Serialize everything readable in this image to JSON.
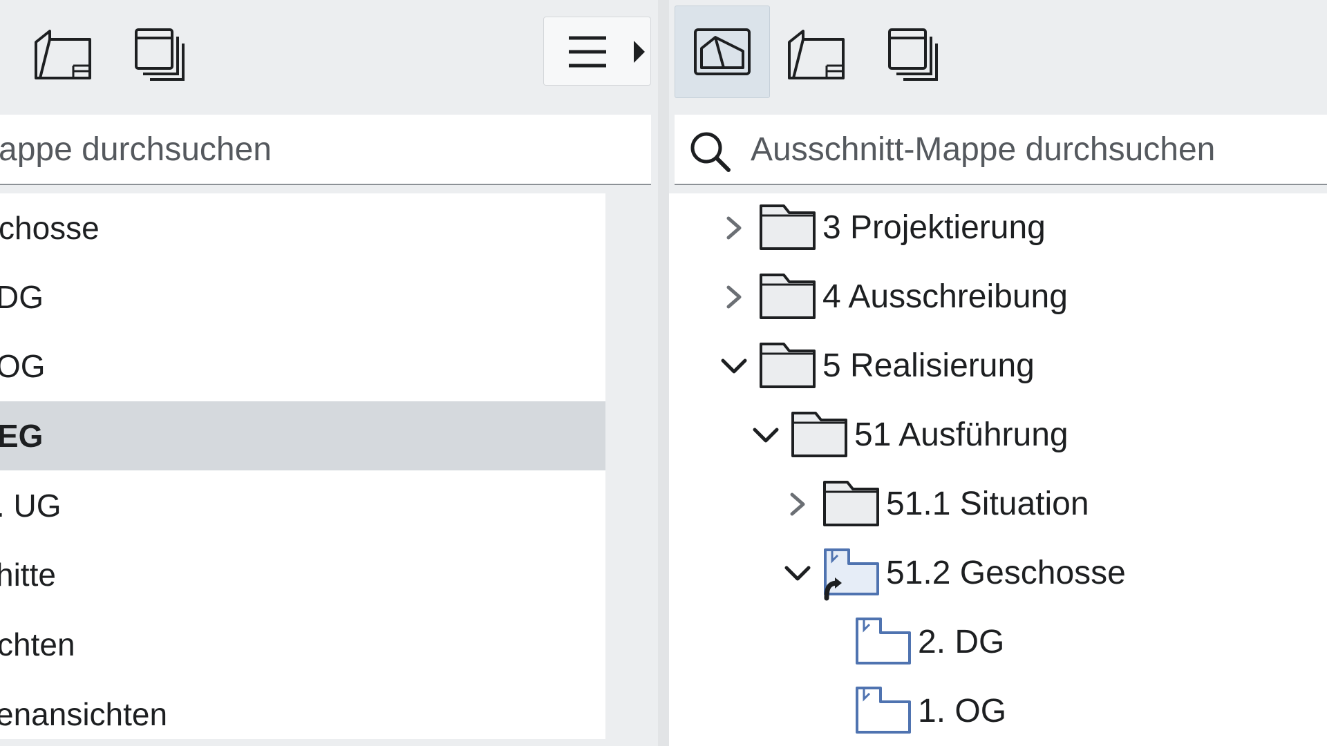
{
  "left_panel": {
    "search_placeholder": "appe durchsuchen",
    "menu_icon": "hamburger-menu-icon",
    "items": [
      {
        "label": "chosse"
      },
      {
        "label": " DG"
      },
      {
        "label": " OG"
      },
      {
        "label": " EG",
        "selected": true
      },
      {
        "label": ". UG"
      },
      {
        "label": "hitte"
      },
      {
        "label": "chten"
      },
      {
        "label": "enansichten"
      }
    ]
  },
  "right_panel": {
    "search_placeholder": "Ausschnitt-Mappe durchsuchen",
    "tree": [
      {
        "label": "3 Projektierung",
        "expanded": false,
        "icon": "folder-icon"
      },
      {
        "label": "4 Ausschreibung",
        "expanded": false,
        "icon": "folder-icon"
      },
      {
        "label": "5 Realisierung",
        "expanded": true,
        "icon": "folder-icon"
      },
      {
        "label": "51 Ausführung",
        "expanded": true,
        "icon": "folder-icon"
      },
      {
        "label": "51.1 Situation",
        "expanded": false,
        "icon": "folder-icon"
      },
      {
        "label": "51.2 Geschosse",
        "expanded": true,
        "icon": "view-folder-shortcut-icon"
      },
      {
        "label": "2. DG",
        "icon": "view-icon"
      },
      {
        "label": "1. OG",
        "icon": "view-icon"
      }
    ]
  },
  "colors": {
    "background": "#eceef0",
    "selection": "#d5d9dd",
    "active_tool": "#dbe3ea",
    "view_icon_blue": "#4f73b0"
  }
}
